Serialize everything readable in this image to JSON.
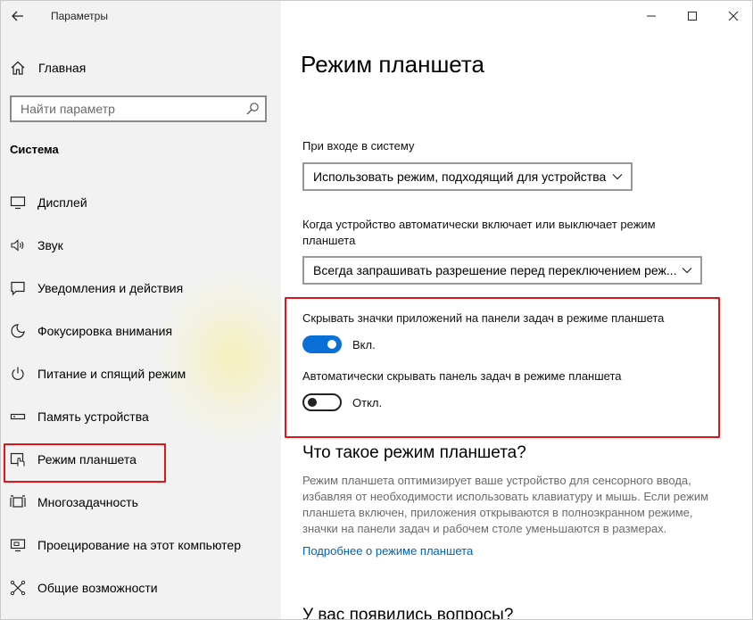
{
  "app": {
    "title": "Параметры"
  },
  "sidebar": {
    "home_label": "Главная",
    "search_placeholder": "Найти параметр",
    "section_label": "Система",
    "items": [
      {
        "label": "Дисплей",
        "icon": "display-icon"
      },
      {
        "label": "Звук",
        "icon": "sound-icon"
      },
      {
        "label": "Уведомления и действия",
        "icon": "notifications-icon"
      },
      {
        "label": "Фокусировка внимания",
        "icon": "moon-icon"
      },
      {
        "label": "Питание и спящий режим",
        "icon": "power-icon"
      },
      {
        "label": "Память устройства",
        "icon": "storage-icon"
      },
      {
        "label": "Режим планшета",
        "icon": "tablet-mode-icon",
        "active": true
      },
      {
        "label": "Многозадачность",
        "icon": "multitasking-icon"
      },
      {
        "label": "Проецирование на этот компьютер",
        "icon": "projecting-icon"
      },
      {
        "label": "Общие возможности",
        "icon": "shared-experiences-icon"
      }
    ]
  },
  "main": {
    "title": "Режим планшета",
    "signin": {
      "label": "При входе в систему",
      "value": "Использовать режим, подходящий для устройства"
    },
    "auto_switch": {
      "label_line1": "Когда устройство автоматически включает или выключает режим",
      "label_line2": "планшета",
      "value": "Всегда запрашивать разрешение перед переключением реж..."
    },
    "hide_icons": {
      "label": "Скрывать значки приложений на панели задач в режиме планшета",
      "state": "Вкл.",
      "on": true
    },
    "hide_taskbar": {
      "label": "Автоматически скрывать панель задач в режиме планшета",
      "state": "Откл.",
      "on": false
    },
    "what_is": {
      "heading": "Что такое режим планшета?",
      "line1": "Режим планшета оптимизирует ваше устройство для сенсорного ввода,",
      "line2": "избавляя от необходимости использовать клавиатуру и мышь. Если режим",
      "line3": "планшета включен, приложения открываются в полноэкранном режиме,",
      "line4": "значки на панели задач и рабочем столе уменьшаются в размерах.",
      "link": "Подробнее о режиме планшета"
    },
    "questions_heading": "У вас появились вопросы?"
  },
  "colors": {
    "accent": "#0a6fd6",
    "highlight": "#e0141b",
    "link": "#0063b1",
    "sidebar_bg": "#f2f2f2"
  }
}
